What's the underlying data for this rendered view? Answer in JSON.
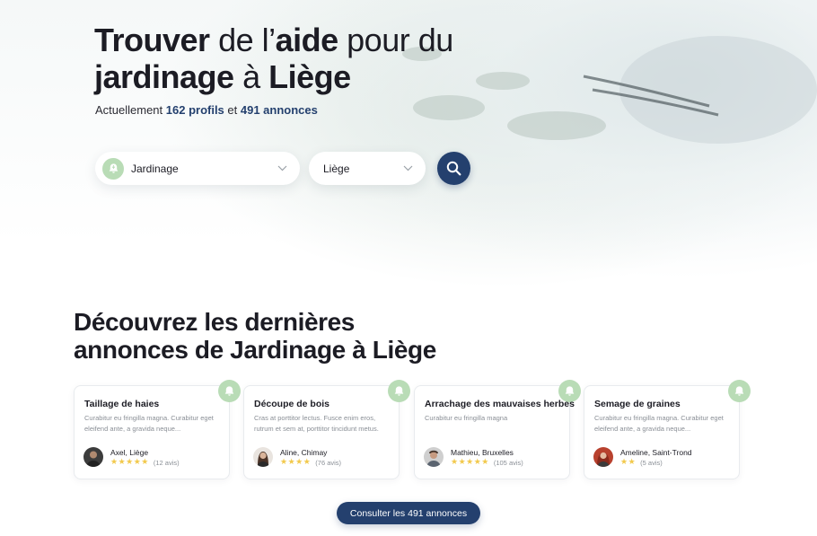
{
  "hero": {
    "title_w1": "Trouver",
    "title_w2": "de l’",
    "title_w3": "aide",
    "title_w4": " pour du",
    "title_w5": "jardinage",
    "title_w6": " à ",
    "title_w7": "Liège",
    "sub_prefix": "Actuellement ",
    "profiles": "162 profils",
    "sub_and": " et ",
    "ads": "491 annonces"
  },
  "search": {
    "category_value": "Jardinage",
    "city_value": "Liège",
    "category_icon": "gardening-bell-icon",
    "search_icon": "search-icon"
  },
  "section": {
    "t1": "Découvrez",
    "t2": " les dernières",
    "t3": "annonces",
    "t4": " de ",
    "t5": "Jardinage",
    "t6": " à ",
    "t7": "Liège"
  },
  "cards": [
    {
      "title": "Taillage de haies",
      "desc": "Curabitur eu fringilla magna. Curabitur eget eleifend ante, a gravida neque...",
      "author": "Axel, Liège",
      "stars": "★★★★★",
      "reviews": "(12 avis)"
    },
    {
      "title": "Découpe de bois",
      "desc": " Cras at porttitor lectus. Fusce enim eros, rutrum et sem at, porttitor tincidunt metus.",
      "author": "Aline, Chimay",
      "stars": "★★★★",
      "reviews": "(76 avis)"
    },
    {
      "title": "Arrachage des mauvaises herbes",
      "desc": "Curabitur eu fringilla magna",
      "author": "Mathieu, Bruxelles",
      "stars": "★★★★★",
      "reviews": "(105 avis)"
    },
    {
      "title": "Semage de graines",
      "desc": "Curabitur eu fringilla magna. Curabitur eget eleifend ante, a gravida neque...",
      "author": "Ameline, Saint-Trond",
      "stars": "★★",
      "reviews": "(5 avis)"
    }
  ],
  "cta_label": "Consulter les 491 annonces",
  "colors": {
    "accent": "#24406e",
    "badge": "#b9dcb6",
    "star": "#f2c94c"
  }
}
